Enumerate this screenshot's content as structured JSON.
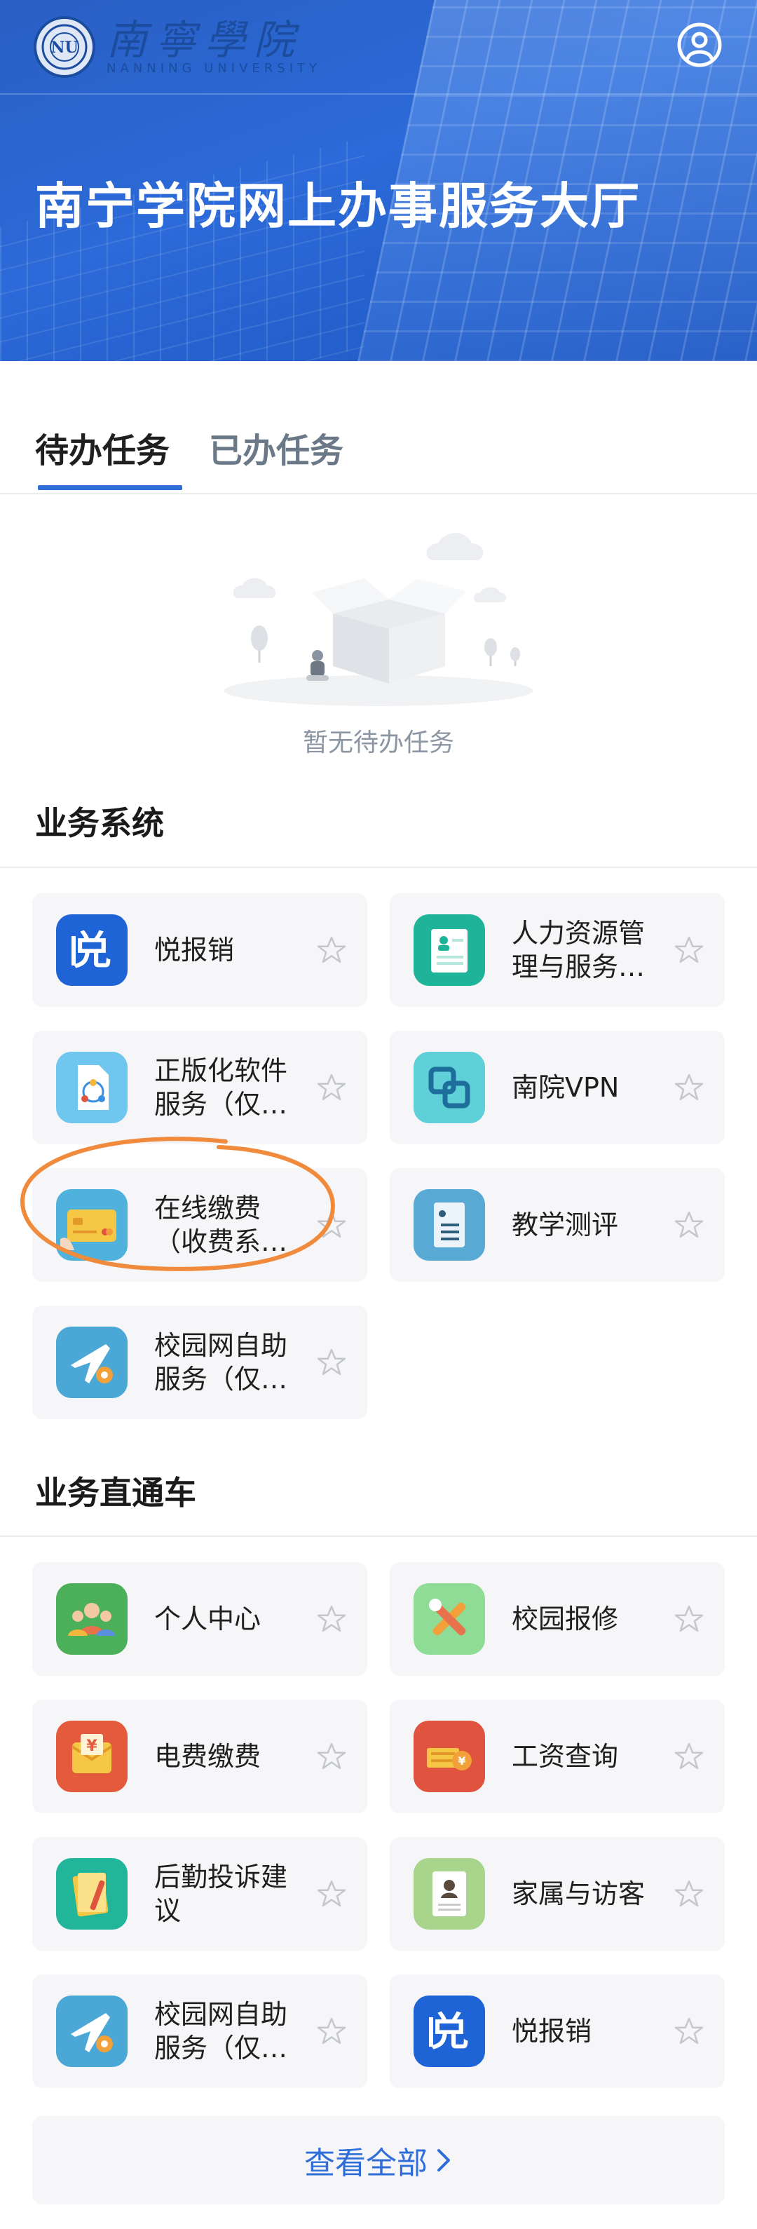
{
  "header": {
    "logo_cn": "南寧學院",
    "logo_en": "NANNING UNIVERSITY",
    "title": "南宁学院网上办事服务大厅"
  },
  "tabs": [
    {
      "label": "待办任务",
      "active": true
    },
    {
      "label": "已办任务",
      "active": false
    }
  ],
  "empty_state": {
    "text": "暂无待办任务"
  },
  "business_systems": {
    "title": "业务系统",
    "items": [
      {
        "label": "悦报销",
        "icon": "yue-receipt-icon"
      },
      {
        "label": "人力资源管理与服务…",
        "icon": "hr-document-icon"
      },
      {
        "label": "正版化软件服务（仅…",
        "icon": "software-file-icon"
      },
      {
        "label": "南院VPN",
        "icon": "vpn-link-icon"
      },
      {
        "label": "在线缴费（收费系…",
        "icon": "credit-card-icon"
      },
      {
        "label": "教学测评",
        "icon": "evaluation-doc-icon"
      },
      {
        "label": "校园网自助服务（仅…",
        "icon": "network-plane-icon"
      }
    ]
  },
  "direct_services": {
    "title": "业务直通车",
    "items": [
      {
        "label": "个人中心",
        "icon": "people-icon"
      },
      {
        "label": "校园报修",
        "icon": "repair-tools-icon"
      },
      {
        "label": "电费缴费",
        "icon": "yuan-envelope-icon"
      },
      {
        "label": "工资查询",
        "icon": "salary-coins-icon"
      },
      {
        "label": "后勤投诉建议",
        "icon": "complaint-note-icon"
      },
      {
        "label": "家属与访客",
        "icon": "visitor-card-icon"
      },
      {
        "label": "校园网自助服务（仅…",
        "icon": "network-plane-icon"
      },
      {
        "label": "悦报销",
        "icon": "yue-receipt-icon"
      }
    ]
  },
  "view_all": {
    "label": "查看全部"
  },
  "colors": {
    "brand_blue": "#2f6ed8",
    "annotation_orange": "#f08a3c"
  }
}
